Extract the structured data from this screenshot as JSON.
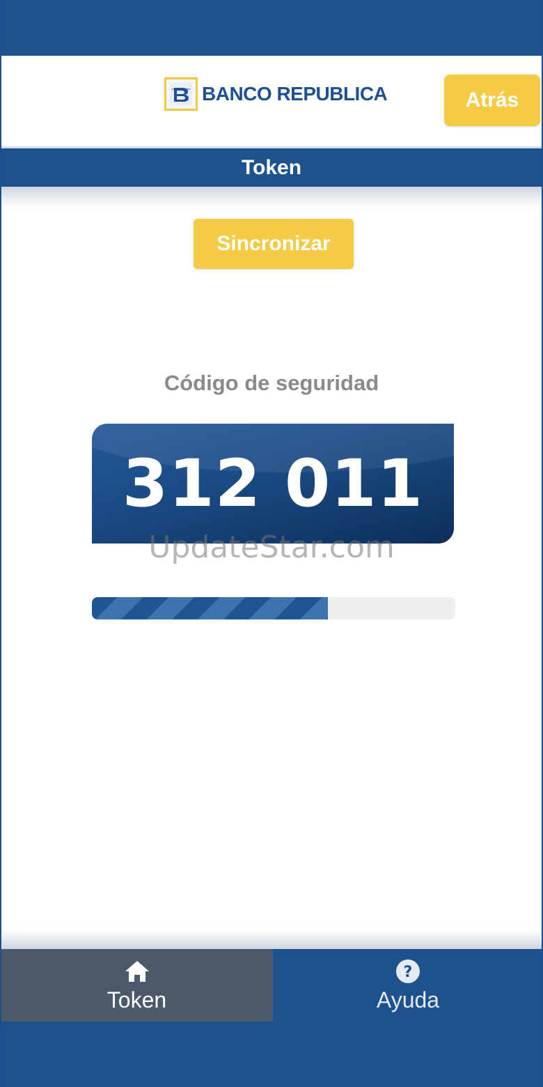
{
  "header": {
    "logo_text": "BANCO REPUBLICA",
    "back_label": "Atrás"
  },
  "title_bar": {
    "title": "Token"
  },
  "actions": {
    "sync_label": "Sincronizar"
  },
  "token": {
    "code_label": "Código de seguridad",
    "code_value": "312 011",
    "progress_fraction": 0.65
  },
  "watermark": {
    "text": "UpdateStar.com"
  },
  "bottom_nav": {
    "items": [
      {
        "label": "Token",
        "icon": "home-icon",
        "active": true
      },
      {
        "label": "Ayuda",
        "icon": "help-icon",
        "active": false
      }
    ]
  },
  "colors": {
    "primary_blue": "#1d528f",
    "accent_yellow": "#f5ca45",
    "active_tab": "#4b5968",
    "label_gray": "#8a8a8a"
  }
}
